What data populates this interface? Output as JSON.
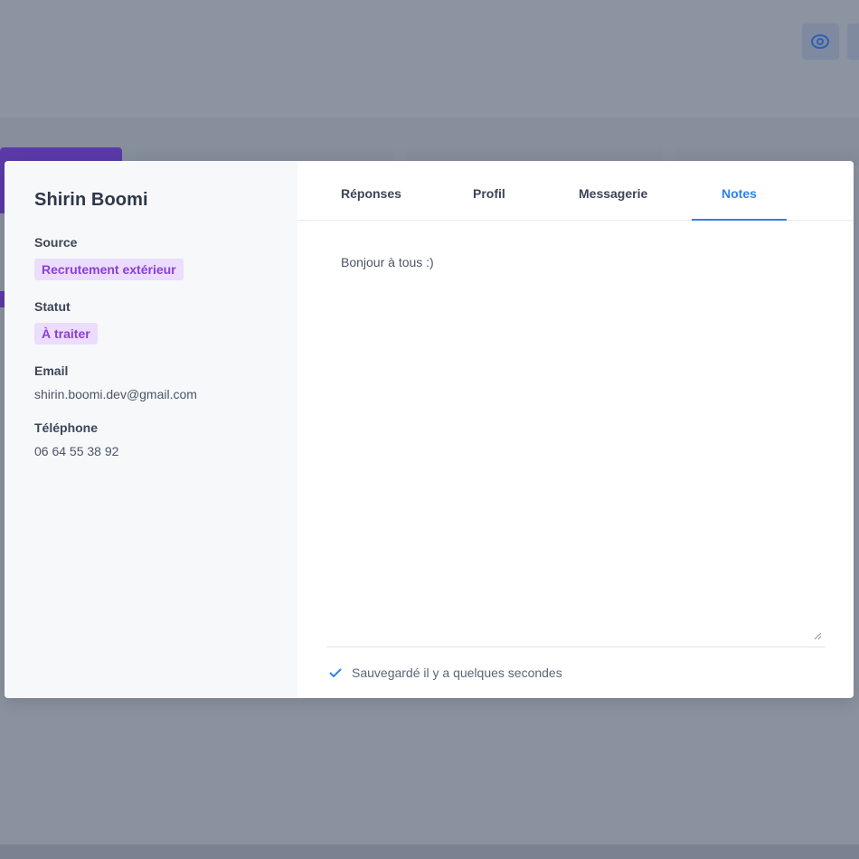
{
  "candidate": {
    "name": "Shirin Boomi",
    "source_label": "Source",
    "source_value": "Recrutement extérieur",
    "status_label": "Statut",
    "status_value": "À traiter",
    "email_label": "Email",
    "email_value": "shirin.boomi.dev@gmail.com",
    "phone_label": "Téléphone",
    "phone_value": "06 64 55 38 92"
  },
  "tabs": [
    {
      "label": "Réponses"
    },
    {
      "label": "Profil"
    },
    {
      "label": "Messagerie"
    },
    {
      "label": "Notes",
      "active": true
    }
  ],
  "notes": {
    "value": "Bonjour à tous :)",
    "save_status": "Sauvegardé il y a quelques secondes"
  },
  "icons": [
    "eye-icon",
    "check-icon",
    "resize-grip-icon"
  ],
  "colors": {
    "accent": "#2f80ed",
    "badge_bg": "#ecdcfd",
    "badge_text": "#8a3fd6",
    "overlay": "#8a919f"
  }
}
